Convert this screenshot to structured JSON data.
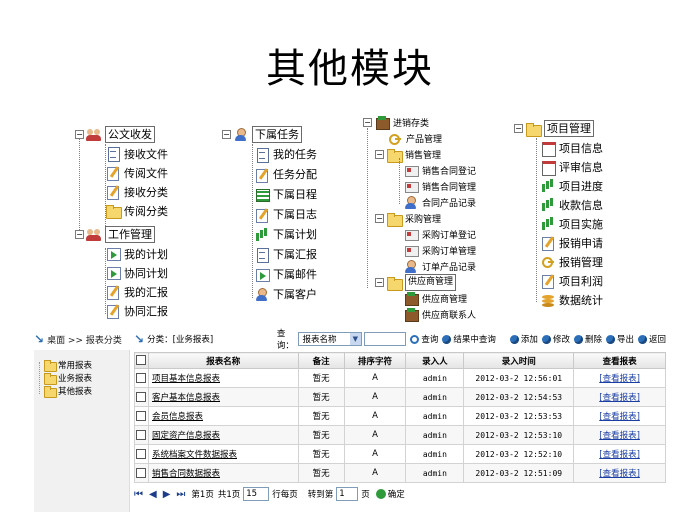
{
  "slide_title": "其他模块",
  "trees": {
    "office": {
      "root": "公文收发",
      "items": [
        "接收文件",
        "传阅文件",
        "接收分类",
        "传阅分类"
      ],
      "root2": "工作管理",
      "items2": [
        "我的计划",
        "协同计划",
        "我的汇报",
        "协同汇报"
      ]
    },
    "tasks": {
      "root": "下属任务",
      "items": [
        "我的任务",
        "任务分配",
        "下属日程",
        "下属日志",
        "下属计划",
        "下属汇报",
        "下属邮件",
        "下属客户"
      ]
    },
    "inventory": {
      "root": "进销存类",
      "products": "产品管理",
      "sales": "销售管理",
      "sales_items": [
        "销售合同登记",
        "销售合同管理",
        "合同产品记录"
      ],
      "purchase": "采购管理",
      "purchase_items": [
        "采购订单登记",
        "采购订单管理",
        "订单产品记录"
      ],
      "supplier": "供应商管理",
      "supplier_items": [
        "供应商管理",
        "供应商联系人"
      ]
    },
    "project": {
      "root": "项目管理",
      "items": [
        "项目信息",
        "评审信息",
        "项目进度",
        "收款信息",
        "项目实施",
        "报销申请",
        "报销管理",
        "项目利润",
        "数据统计"
      ]
    }
  },
  "app": {
    "side_header": "桌面 >> 报表分类",
    "side_items": [
      "常用报表",
      "业务报表",
      "其他报表"
    ],
    "breadcrumb": "分类：[业务报表]",
    "query_label": "查询：",
    "select_value": "报表名称",
    "buttons": [
      "查询",
      "结果中查询",
      "添加",
      "修改",
      "删除",
      "导出",
      "返回"
    ],
    "columns": [
      "报表名称",
      "备注",
      "排序字符",
      "录入人",
      "录入时间",
      "查看报表"
    ],
    "rows": [
      {
        "name": "项目基本信息报表",
        "note": "暂无",
        "sort": "A",
        "user": "admin",
        "time": "2012-03-2 12:56:01",
        "view": "[查看报表]"
      },
      {
        "name": "客户基本信息报表",
        "note": "暂无",
        "sort": "A",
        "user": "admin",
        "time": "2012-03-2 12:54:53",
        "view": "[查看报表]"
      },
      {
        "name": "会员信息报表",
        "note": "暂无",
        "sort": "A",
        "user": "admin",
        "time": "2012-03-2 12:53:53",
        "view": "[查看报表]"
      },
      {
        "name": "固定资产信息报表",
        "note": "暂无",
        "sort": "A",
        "user": "admin",
        "time": "2012-03-2 12:53:10",
        "view": "[查看报表]"
      },
      {
        "name": "系统档案文件数据报表",
        "note": "暂无",
        "sort": "A",
        "user": "admin",
        "time": "2012-03-2 12:52:10",
        "view": "[查看报表]"
      },
      {
        "name": "销售合同数据报表",
        "note": "暂无",
        "sort": "A",
        "user": "admin",
        "time": "2012-03-2 12:51:09",
        "view": "[查看报表]"
      }
    ],
    "pager": {
      "page_text": "第1页",
      "total_text": "共1页",
      "per_page": "15",
      "per_page_label": "行每页",
      "goto_label": "转到第",
      "goto_value": "1",
      "page_unit": "页",
      "confirm": "确定"
    }
  }
}
